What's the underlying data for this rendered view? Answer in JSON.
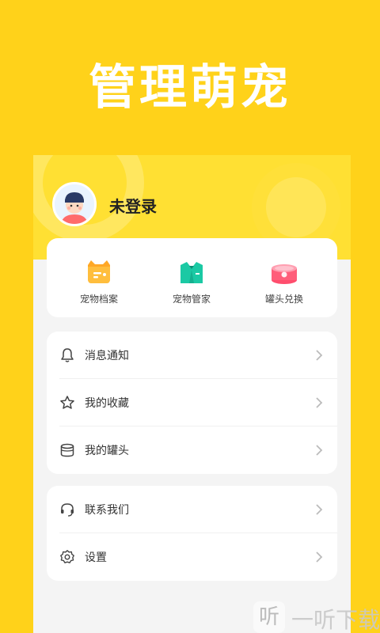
{
  "hero": {
    "title": "管理萌宠"
  },
  "profile": {
    "login_text": "未登录"
  },
  "shortcuts": [
    {
      "label": "宠物档案",
      "icon": "pet-profile-icon",
      "color": "#FFA826"
    },
    {
      "label": "宠物管家",
      "icon": "pet-butler-icon",
      "color": "#1BC9A4"
    },
    {
      "label": "罐头兑换",
      "icon": "can-exchange-icon",
      "color": "#FF5E7A"
    }
  ],
  "menu_primary": [
    {
      "label": "消息通知",
      "icon": "bell-icon"
    },
    {
      "label": "我的收藏",
      "icon": "star-icon"
    },
    {
      "label": "我的罐头",
      "icon": "can-icon"
    }
  ],
  "menu_secondary": [
    {
      "label": "联系我们",
      "icon": "headset-icon"
    },
    {
      "label": "设置",
      "icon": "gear-icon"
    }
  ],
  "watermark": {
    "glyph": "听",
    "text": "一听下载"
  },
  "colors": {
    "background": "#FFD21A",
    "header": "#FFE033",
    "panel": "#F4F4F4"
  }
}
